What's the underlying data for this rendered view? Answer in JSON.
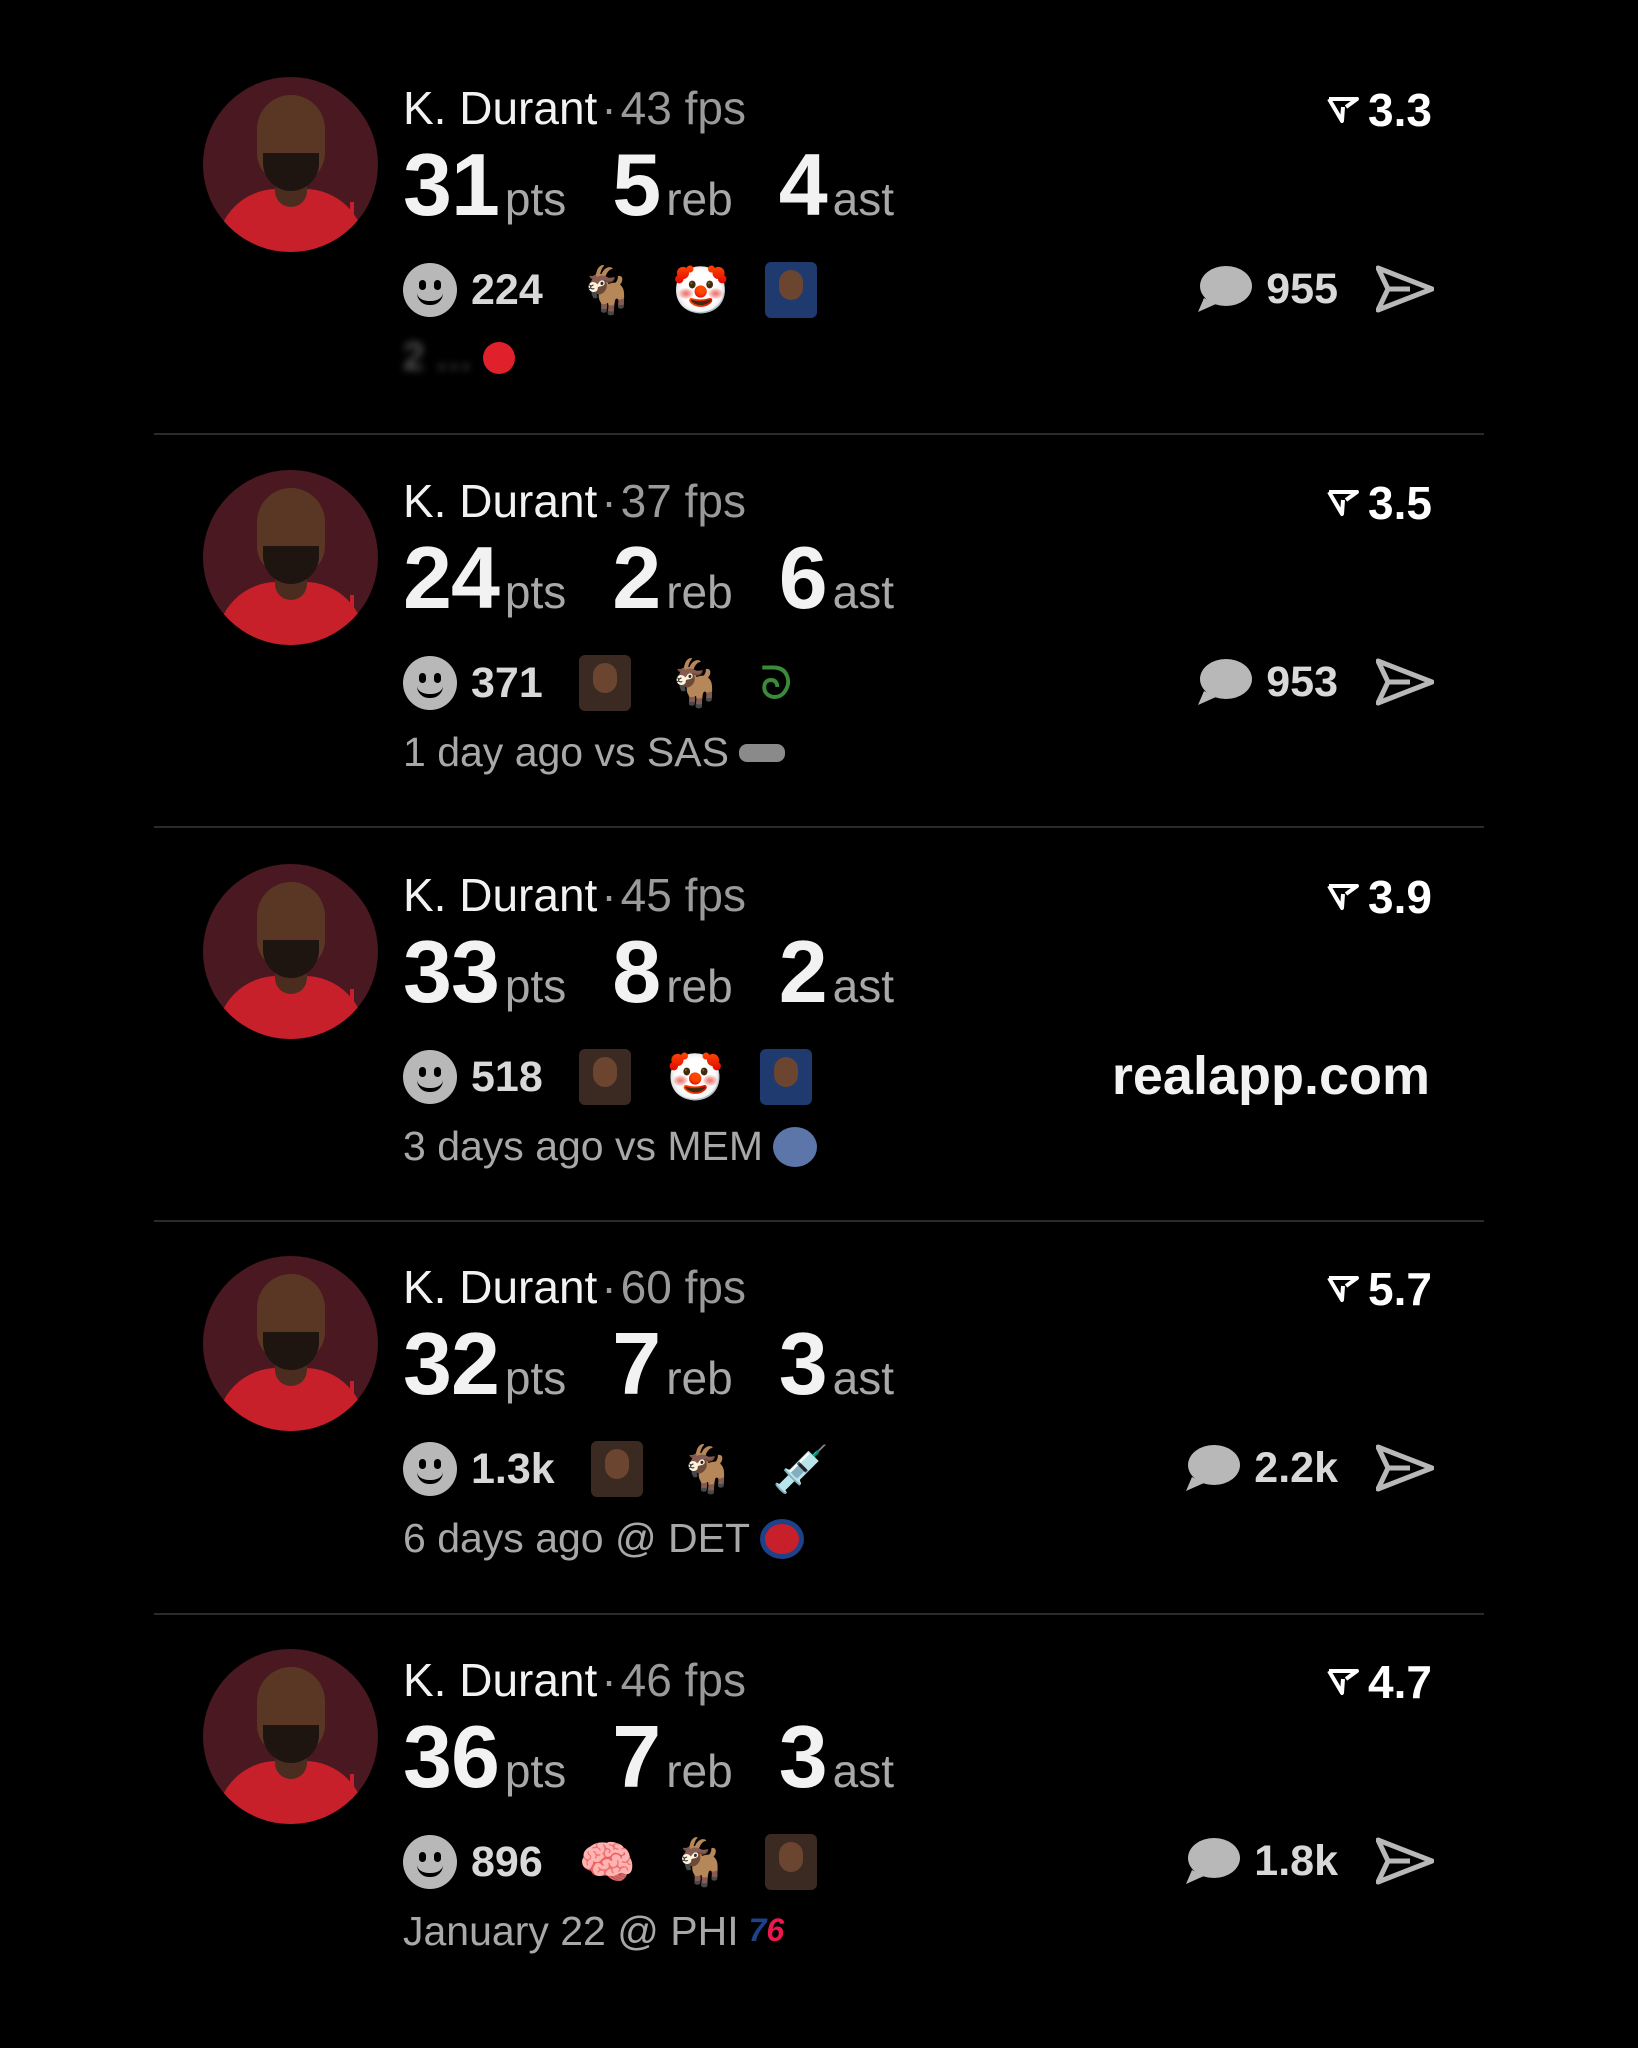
{
  "posts": [
    {
      "name": "K. Durant",
      "fps": "43 fps",
      "rating": "3.3",
      "stats": {
        "pts": "31",
        "reb": "5",
        "ast": "4"
      },
      "units": {
        "pts": "pts",
        "reb": "reb",
        "ast": "ast"
      },
      "reactions": "224",
      "reaction_emojis": [
        "goat-emoji",
        "clown-emoji",
        "player-photo"
      ],
      "comments": "955",
      "footer": "2 …",
      "team_icon": "heart-red"
    },
    {
      "name": "K. Durant",
      "fps": "37 fps",
      "rating": "3.5",
      "stats": {
        "pts": "24",
        "reb": "2",
        "ast": "6"
      },
      "units": {
        "pts": "pts",
        "reb": "reb",
        "ast": "ast"
      },
      "reactions": "371",
      "reaction_emojis": [
        "player-photo",
        "goat-emoji",
        "snake-emoji"
      ],
      "comments": "953",
      "footer": "1 day ago vs SAS",
      "team_icon": "spurs-logo"
    },
    {
      "name": "K. Durant",
      "fps": "45 fps",
      "rating": "3.9",
      "stats": {
        "pts": "33",
        "reb": "8",
        "ast": "2"
      },
      "units": {
        "pts": "pts",
        "reb": "reb",
        "ast": "ast"
      },
      "reactions": "518",
      "reaction_emojis": [
        "player-photo",
        "clown-emoji",
        "player-photo"
      ],
      "watermark": "realapp.com",
      "footer": "3 days ago vs MEM",
      "team_icon": "grizzlies-logo"
    },
    {
      "name": "K. Durant",
      "fps": "60 fps",
      "rating": "5.7",
      "stats": {
        "pts": "32",
        "reb": "7",
        "ast": "3"
      },
      "units": {
        "pts": "pts",
        "reb": "reb",
        "ast": "ast"
      },
      "reactions": "1.3k",
      "reaction_emojis": [
        "player-photo",
        "goat-emoji",
        "syringe-emoji"
      ],
      "comments": "2.2k",
      "footer": "6 days ago @ DET",
      "team_icon": "pistons-logo"
    },
    {
      "name": "K. Durant",
      "fps": "46 fps",
      "rating": "4.7",
      "stats": {
        "pts": "36",
        "reb": "7",
        "ast": "3"
      },
      "units": {
        "pts": "pts",
        "reb": "reb",
        "ast": "ast"
      },
      "reactions": "896",
      "reaction_emojis": [
        "brain-emoji",
        "goat-emoji",
        "player-photo"
      ],
      "comments": "1.8k",
      "footer": "January 22 @ PHI",
      "team_icon": "76ers-logo"
    }
  ],
  "colors": {
    "background": "#000000",
    "text_primary": "#f2f2f2",
    "text_secondary": "#a8a8a8",
    "divider": "#2a2a2a",
    "jersey_red": "#c8202b"
  }
}
